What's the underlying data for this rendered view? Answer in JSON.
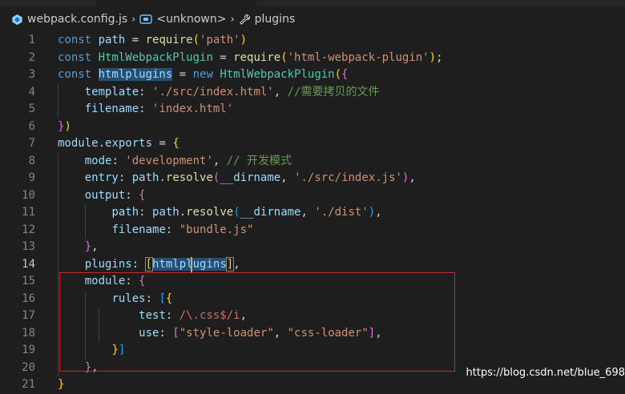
{
  "breadcrumb": {
    "file": "webpack.config.js",
    "unknown": "<unknown>",
    "plugins": "plugins"
  },
  "lines": [
    {
      "n": "1",
      "tokens": [
        [
          "k",
          "const "
        ],
        [
          "v",
          "path"
        ],
        [
          "p",
          " = "
        ],
        [
          "f",
          "require"
        ],
        [
          "b1",
          "("
        ],
        [
          "s",
          "'path'"
        ],
        [
          "b1",
          ")"
        ]
      ]
    },
    {
      "n": "2",
      "tokens": [
        [
          "k",
          "const "
        ],
        [
          "c4",
          "HtmlWebpackPlugin"
        ],
        [
          "p",
          " = "
        ],
        [
          "f",
          "require"
        ],
        [
          "b1",
          "("
        ],
        [
          "s",
          "'html-webpack-plugin'"
        ],
        [
          "b1",
          ")"
        ],
        [
          "p",
          ";"
        ]
      ]
    },
    {
      "n": "3",
      "tokens": [
        [
          "k",
          "const "
        ],
        [
          "vh",
          "htmlplugins"
        ],
        [
          "p",
          " = "
        ],
        [
          "k",
          "new "
        ],
        [
          "c4",
          "HtmlWebpackPlugin"
        ],
        [
          "b1",
          "("
        ],
        [
          "b2",
          "{"
        ]
      ]
    },
    {
      "n": "4",
      "tokens": [
        [
          "p",
          "    "
        ],
        [
          "v",
          "template"
        ],
        [
          "p",
          ": "
        ],
        [
          "s",
          "'./src/index.html'"
        ],
        [
          "p",
          ", "
        ],
        [
          "cm",
          "//需要拷贝的文件"
        ]
      ]
    },
    {
      "n": "5",
      "tokens": [
        [
          "p",
          "    "
        ],
        [
          "v",
          "filename"
        ],
        [
          "p",
          ": "
        ],
        [
          "s",
          "'index.html'"
        ]
      ]
    },
    {
      "n": "6",
      "tokens": [
        [
          "b2",
          "}"
        ],
        [
          "b1",
          ")"
        ]
      ]
    },
    {
      "n": "7",
      "tokens": [
        [
          "v",
          "module"
        ],
        [
          "p",
          "."
        ],
        [
          "v",
          "exports"
        ],
        [
          "p",
          " = "
        ],
        [
          "b1",
          "{"
        ]
      ]
    },
    {
      "n": "8",
      "tokens": [
        [
          "p",
          "    "
        ],
        [
          "v",
          "mode"
        ],
        [
          "p",
          ": "
        ],
        [
          "s",
          "'development'"
        ],
        [
          "p",
          ", "
        ],
        [
          "cm",
          "// 开发模式"
        ]
      ]
    },
    {
      "n": "9",
      "tokens": [
        [
          "p",
          "    "
        ],
        [
          "v",
          "entry"
        ],
        [
          "p",
          ": "
        ],
        [
          "v",
          "path"
        ],
        [
          "p",
          "."
        ],
        [
          "f",
          "resolve"
        ],
        [
          "b2",
          "("
        ],
        [
          "v",
          "__dirname"
        ],
        [
          "p",
          ", "
        ],
        [
          "s",
          "'./src/index.js'"
        ],
        [
          "b2",
          ")"
        ],
        [
          "p",
          ","
        ]
      ]
    },
    {
      "n": "10",
      "tokens": [
        [
          "p",
          "    "
        ],
        [
          "v",
          "output"
        ],
        [
          "p",
          ": "
        ],
        [
          "b2",
          "{"
        ]
      ]
    },
    {
      "n": "11",
      "tokens": [
        [
          "p",
          "        "
        ],
        [
          "v",
          "path"
        ],
        [
          "p",
          ": "
        ],
        [
          "v",
          "path"
        ],
        [
          "p",
          "."
        ],
        [
          "f",
          "resolve"
        ],
        [
          "b3",
          "("
        ],
        [
          "v",
          "__dirname"
        ],
        [
          "p",
          ", "
        ],
        [
          "s",
          "'./dist'"
        ],
        [
          "b3",
          ")"
        ],
        [
          "p",
          ","
        ]
      ]
    },
    {
      "n": "12",
      "tokens": [
        [
          "p",
          "        "
        ],
        [
          "v",
          "filename"
        ],
        [
          "p",
          ": "
        ],
        [
          "s",
          "\"bundle.js\""
        ]
      ]
    },
    {
      "n": "13",
      "tokens": [
        [
          "p",
          "    "
        ],
        [
          "b2",
          "}"
        ],
        [
          "p",
          ","
        ]
      ]
    },
    {
      "n": "14",
      "tokens": [
        [
          "p",
          "    "
        ],
        [
          "v",
          "plugins"
        ],
        [
          "p",
          ": "
        ],
        [
          "bb",
          "["
        ],
        [
          "vhl",
          "htmlplugins"
        ],
        [
          "bb",
          "]"
        ],
        [
          "p",
          ","
        ]
      ]
    },
    {
      "n": "15",
      "tokens": [
        [
          "p",
          "    "
        ],
        [
          "v",
          "module"
        ],
        [
          "p",
          ": "
        ],
        [
          "b2",
          "{"
        ]
      ]
    },
    {
      "n": "16",
      "tokens": [
        [
          "p",
          "        "
        ],
        [
          "v",
          "rules"
        ],
        [
          "p",
          ": "
        ],
        [
          "b3",
          "["
        ],
        [
          "b1",
          "{"
        ]
      ]
    },
    {
      "n": "17",
      "tokens": [
        [
          "p",
          "            "
        ],
        [
          "v",
          "test"
        ],
        [
          "p",
          ": "
        ],
        [
          "rx",
          "/\\.css$/i"
        ],
        [
          "p",
          ","
        ]
      ]
    },
    {
      "n": "18",
      "tokens": [
        [
          "p",
          "            "
        ],
        [
          "v",
          "use"
        ],
        [
          "p",
          ": "
        ],
        [
          "b2",
          "["
        ],
        [
          "s",
          "\"style-loader\""
        ],
        [
          "p",
          ", "
        ],
        [
          "s",
          "\"css-loader\""
        ],
        [
          "b2",
          "]"
        ],
        [
          "p",
          ","
        ]
      ]
    },
    {
      "n": "19",
      "tokens": [
        [
          "p",
          "        "
        ],
        [
          "b1",
          "}"
        ],
        [
          "b3",
          "]"
        ]
      ]
    },
    {
      "n": "20",
      "tokens": [
        [
          "p",
          "    "
        ],
        [
          "b2",
          "}"
        ],
        [
          "p",
          ","
        ]
      ]
    },
    {
      "n": "21",
      "tokens": [
        [
          "b1",
          "}"
        ]
      ]
    }
  ],
  "current_line": "14",
  "watermark": "https://blog.csdn.net/blue_698",
  "colors": {
    "background": "#1e1e1e",
    "keyword": "#569cd6",
    "variable": "#9cdcfe",
    "class": "#4ec9b0",
    "string": "#ce9178",
    "function": "#dcdcaa",
    "comment": "#6a9955",
    "annotation_box": "#c82828"
  }
}
